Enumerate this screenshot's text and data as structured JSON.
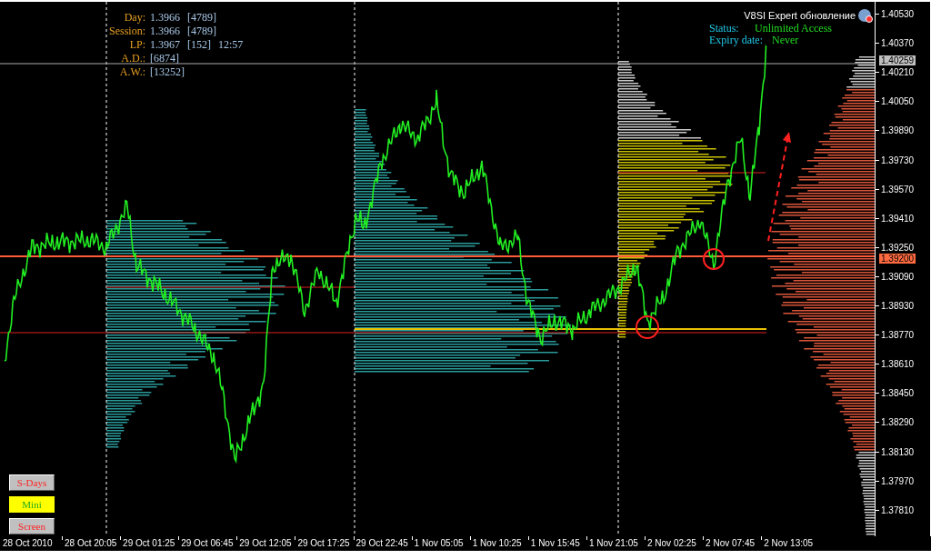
{
  "info_panel": [
    {
      "label": "Day:",
      "values": [
        "1.3966",
        "[4789]"
      ]
    },
    {
      "label": "Session:",
      "values": [
        "1.3966",
        "[4789]"
      ]
    },
    {
      "label": "LP:",
      "values": [
        "1.3967",
        "[152]",
        "12:57"
      ]
    },
    {
      "label": "A.D.:",
      "values": [
        "[6874]"
      ]
    },
    {
      "label": "A.W.:",
      "values": [
        "[13252]"
      ]
    }
  ],
  "expert": {
    "title": "V8SI Expert обновление",
    "status_label": "Status:",
    "status": "Unlimited Access",
    "expiry_label": "Expiry date:",
    "expiry": "Never"
  },
  "price_axis": {
    "ticks": [
      "1.40530",
      "1.40370",
      "1.40210",
      "1.40050",
      "1.39890",
      "1.39730",
      "1.39570",
      "1.39410",
      "1.39250",
      "1.39090",
      "1.38930",
      "1.38770",
      "1.38610",
      "1.38450",
      "1.38290",
      "1.38130",
      "1.37970",
      "1.37810"
    ],
    "markers": [
      {
        "kind": "current",
        "label": "1.40259"
      },
      {
        "kind": "level",
        "label": "1.39200"
      }
    ]
  },
  "time_axis": [
    "28 Oct 2010",
    "28 Oct 20:05",
    "29 Oct 01:25",
    "29 Oct 06:45",
    "29 Oct 12:05",
    "29 Oct 17:25",
    "29 Oct 22:45",
    "1 Nov 05:05",
    "1 Nov 10:25",
    "1 Nov 15:45",
    "1 Nov 21:05",
    "2 Nov 02:25",
    "2 Nov 07:45",
    "2 Nov 13:05"
  ],
  "buttons": [
    {
      "label": "S-Days",
      "selected": false
    },
    {
      "label": "Mini",
      "selected": true
    },
    {
      "label": "Screen",
      "selected": false
    }
  ]
}
